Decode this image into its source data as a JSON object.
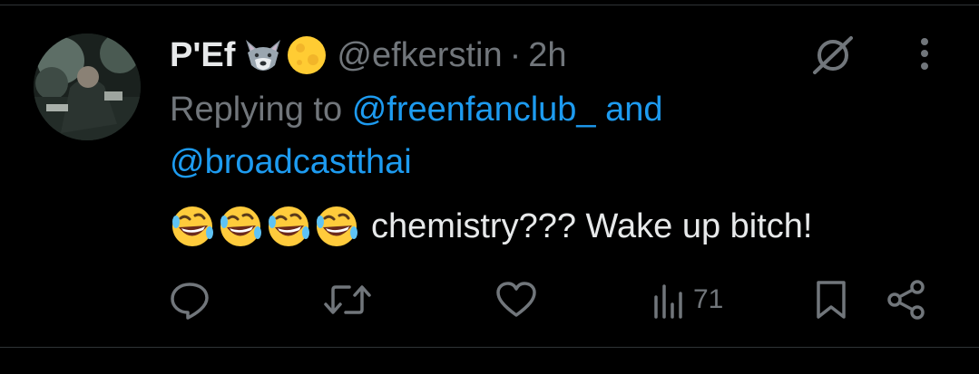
{
  "tweet": {
    "author_name": "P'Ef",
    "handle": "@efkerstin",
    "separator": "·",
    "time": "2h",
    "replying_prefix": "Replying to",
    "reply_mention_1": "@freenfanclub_",
    "reply_and": "and",
    "reply_mention_2": "@broadcastthai",
    "text": "chemistry??? Wake up bitch!",
    "leading_emojis": [
      "rolling-on-floor-laughing",
      "rolling-on-floor-laughing",
      "rolling-on-floor-laughing",
      "rolling-on-floor-laughing"
    ],
    "name_emojis": [
      "wolf",
      "full-moon"
    ]
  },
  "actions": {
    "views": "71"
  },
  "colors": {
    "background": "#000000",
    "text": "#e7e9ea",
    "muted": "#71767b",
    "link": "#1d9bf0",
    "divider": "#2f3336"
  }
}
